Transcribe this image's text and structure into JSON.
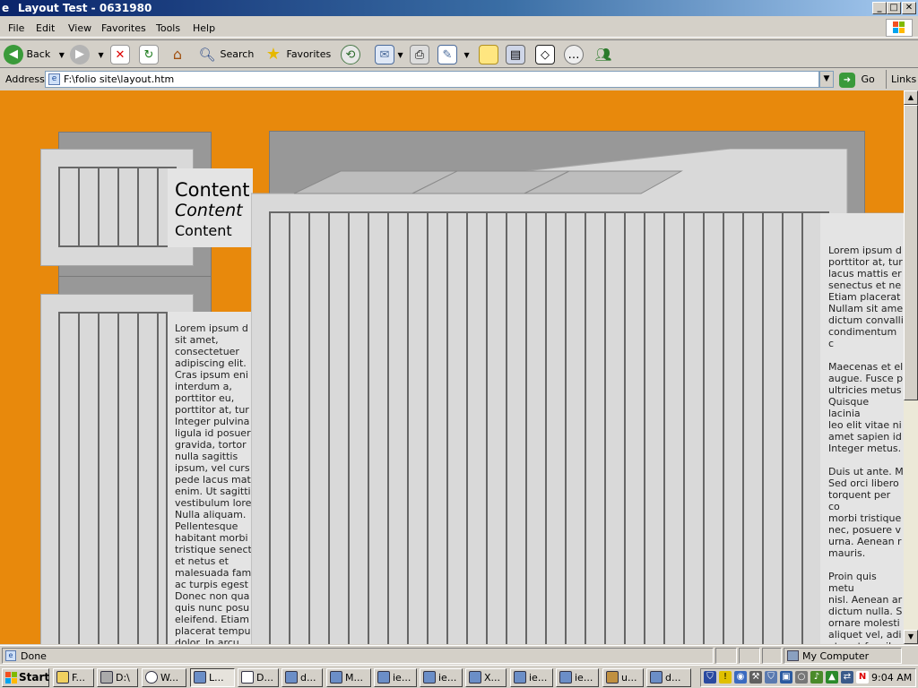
{
  "window": {
    "title": "Layout Test - 0631980",
    "controls": [
      "_",
      "□",
      "✕"
    ]
  },
  "menu": [
    "File",
    "Edit",
    "View",
    "Favorites",
    "Tools",
    "Help"
  ],
  "toolbar": {
    "back_label": "Back",
    "search_label": "Search",
    "favorites_label": "Favorites"
  },
  "address": {
    "label": "Address",
    "value": "F:\\folio site\\layout.htm",
    "go_label": "Go",
    "links_label": "Links"
  },
  "page": {
    "content_heading_1": "Content",
    "content_heading_2": "Content",
    "content_heading_3": "Content",
    "left_lorem": "Lorem ipsum d\nsit amet,\nconsectetuer\nadipiscing elit.\nCras ipsum eni\ninterdum a,\nporttitor eu,\nporttitor at, tur\nInteger pulvina\nligula id posuer\ngravida, tortor\nnulla sagittis\nipsum, vel curs\npede lacus mat\nenim. Ut sagitti\nvestibulum lore\nNulla aliquam.\nPellentesque\nhabitant morbi\ntristique senect\net netus et\nmalesuada fam\nac turpis egest\nDonec non qua\nquis nunc posu\neleifend. Etiam\nplacerat tempu\ndolor. In arcu.",
    "right_lorem": "Lorem ipsum d\nporttitor at, tur\nlacus mattis er\nsenectus et ne\nEtiam placerat\nNullam sit ame\ndictum convalli\ncondimentum c\n\nMaecenas et el\naugue. Fusce p\nultricies metus\nQuisque lacinia\nleo elit vitae ni\namet sapien id\nInteger metus.\n\nDuis ut ante. M\nSed orci libero\ntorquent per co\nmorbi tristique\nnec, posuere v\nurna. Aenean r\nmauris.\n\nProin quis metu\nnisl. Aenean ar\ndictum nulla. S\nornare molesti\naliquet vel, adi\net erat faucibu\n\nMauris feugiat\net malesuada f"
  },
  "status": {
    "text": "Done",
    "zone": "My Computer"
  },
  "taskbar": {
    "start_label": "Start",
    "buttons": [
      "F...",
      "D:\\",
      "W...",
      "L...",
      "D...",
      "d...",
      "M...",
      "ie...",
      "ie...",
      "X...",
      "ie...",
      "ie...",
      "u...",
      "d..."
    ],
    "clock": "9:04 AM"
  },
  "colors": {
    "page_background": "#e8890c",
    "title_gradient_start": "#0a246a",
    "panel_light": "#d9d9d9",
    "panel_dark": "#989898"
  }
}
